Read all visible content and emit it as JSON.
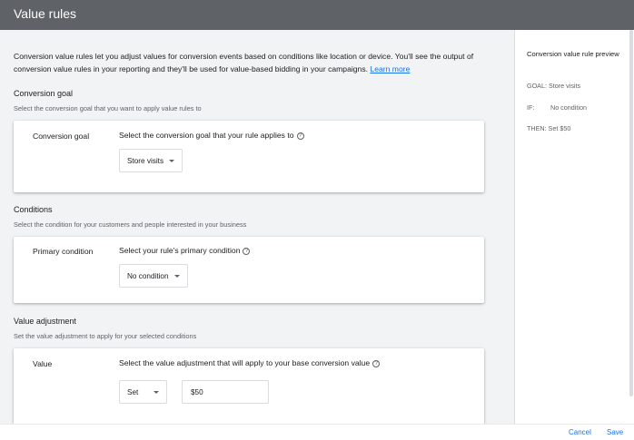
{
  "header": {
    "title": "Value rules"
  },
  "intro": {
    "text": "Conversion value rules let you adjust values for conversion events based on conditions like location or device. You'll see the output of conversion value rules in your reporting and they'll be used for value-based bidding in your campaigns. ",
    "link": "Learn more"
  },
  "sections": {
    "goal": {
      "title": "Conversion goal",
      "subtitle": "Select the conversion goal that you want to apply value rules to",
      "card_label": "Conversion goal",
      "card_desc": "Select the conversion goal that your rule applies to",
      "dropdown_value": "Store visits"
    },
    "conditions": {
      "title": "Conditions",
      "subtitle": "Select the condition for your customers and people interested in your business",
      "card_label": "Primary condition",
      "card_desc": "Select your rule's primary condition",
      "dropdown_value": "No condition"
    },
    "value": {
      "title": "Value adjustment",
      "subtitle": "Set the value adjustment to apply for your selected conditions",
      "card_label": "Value",
      "card_desc": "Select the value adjustment that will apply to your base conversion value",
      "operation_value": "Set",
      "amount_value": "$50"
    }
  },
  "preview": {
    "title": "Conversion value rule preview",
    "goal_line": "GOAL: Store visits",
    "if_label": "IF:",
    "if_value": "No condition",
    "then_line": "THEN:  Set $50"
  },
  "footer": {
    "cancel_label": "Cancel",
    "save_label": "Save"
  },
  "icons": {
    "help": "help-circle-icon",
    "caret": "caret-down-icon"
  },
  "colors": {
    "header_bg": "#5f6368",
    "page_bg": "#f1f3f4",
    "link": "#1a73e8"
  }
}
